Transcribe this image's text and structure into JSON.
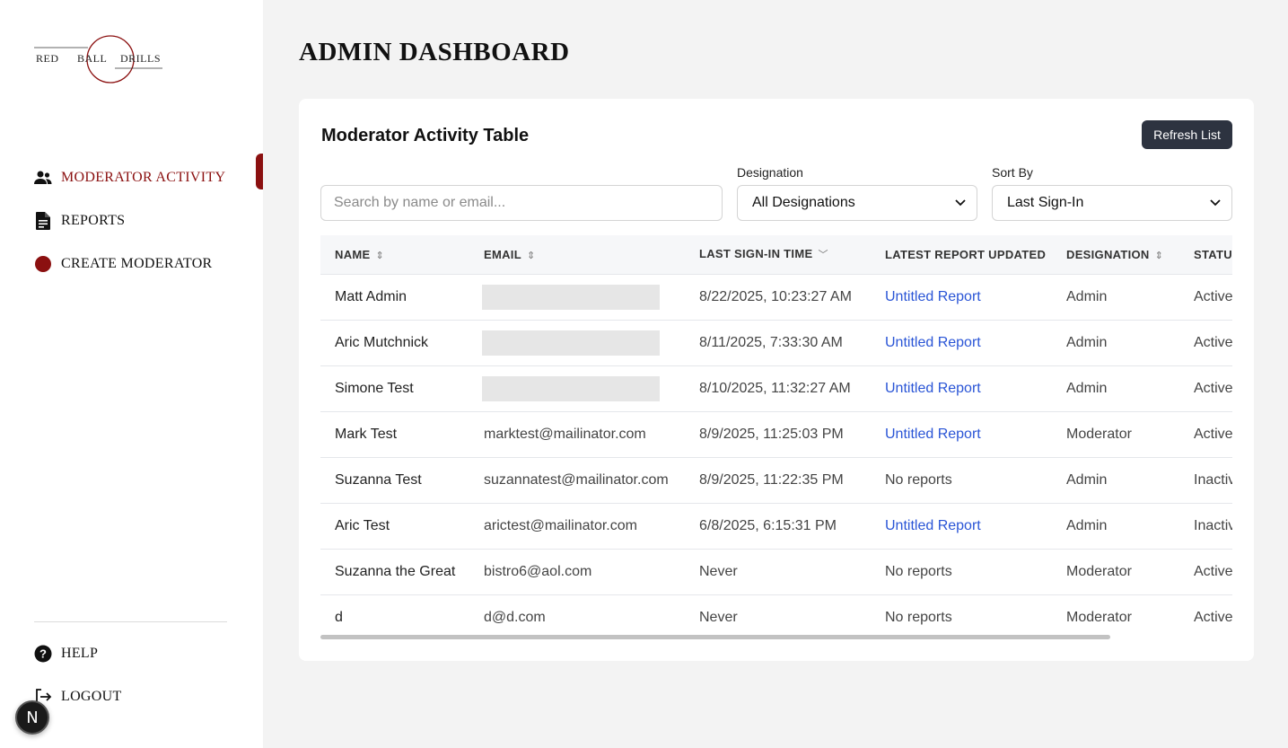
{
  "logo": {
    "text_left": "RED",
    "text_mid": "BALL",
    "text_right": "DRILLS"
  },
  "sidebar": {
    "items": [
      {
        "label": "MODERATOR ACTIVITY",
        "icon": "users-icon",
        "active": true
      },
      {
        "label": "REPORTS",
        "icon": "document-icon",
        "active": false
      },
      {
        "label": "CREATE MODERATOR",
        "icon": "red-dot-icon",
        "active": false
      }
    ],
    "bottom": [
      {
        "label": "HELP",
        "icon": "question-icon"
      },
      {
        "label": "LOGOUT",
        "icon": "logout-icon"
      }
    ],
    "next_badge": "N"
  },
  "page": {
    "title": "ADMIN DASHBOARD"
  },
  "card": {
    "title": "Moderator Activity Table",
    "refresh_label": "Refresh List",
    "search_placeholder": "Search by name or email...",
    "designation_label": "Designation",
    "designation_value": "All Designations",
    "sort_label": "Sort By",
    "sort_value": "Last Sign-In"
  },
  "table": {
    "columns": [
      "NAME",
      "EMAIL",
      "LAST SIGN-IN TIME",
      "LATEST REPORT UPDATED",
      "DESIGNATION",
      "STATUS"
    ],
    "rows": [
      {
        "name": "Matt Admin",
        "email": "",
        "last_sign_in": "8/22/2025, 10:23:27 AM",
        "report": "Untitled Report",
        "designation": "Admin",
        "status": "Active"
      },
      {
        "name": "Aric Mutchnick",
        "email": "",
        "last_sign_in": "8/11/2025, 7:33:30 AM",
        "report": "Untitled Report",
        "designation": "Admin",
        "status": "Active"
      },
      {
        "name": "Simone Test",
        "email": "",
        "last_sign_in": "8/10/2025, 11:32:27 AM",
        "report": "Untitled Report",
        "designation": "Admin",
        "status": "Active"
      },
      {
        "name": "Mark Test",
        "email": "marktest@mailinator.com",
        "last_sign_in": "8/9/2025, 11:25:03 PM",
        "report": "Untitled Report",
        "designation": "Moderator",
        "status": "Active"
      },
      {
        "name": "Suzanna Test",
        "email": "suzannatest@mailinator.com",
        "last_sign_in": "8/9/2025, 11:22:35 PM",
        "report": "No reports",
        "designation": "Admin",
        "status": "Inactive"
      },
      {
        "name": "Aric Test",
        "email": "arictest@mailinator.com",
        "last_sign_in": "6/8/2025, 6:15:31 PM",
        "report": "Untitled Report",
        "designation": "Admin",
        "status": "Inactive"
      },
      {
        "name": "Suzanna the Great",
        "email": "bistro6@aol.com",
        "last_sign_in": "Never",
        "report": "No reports",
        "designation": "Moderator",
        "status": "Active"
      },
      {
        "name": "d",
        "email": "d@d.com",
        "last_sign_in": "Never",
        "report": "No reports",
        "designation": "Moderator",
        "status": "Active"
      }
    ]
  },
  "colors": {
    "accent": "#8b1010",
    "link": "#2a55d6",
    "button": "#2d3340"
  }
}
